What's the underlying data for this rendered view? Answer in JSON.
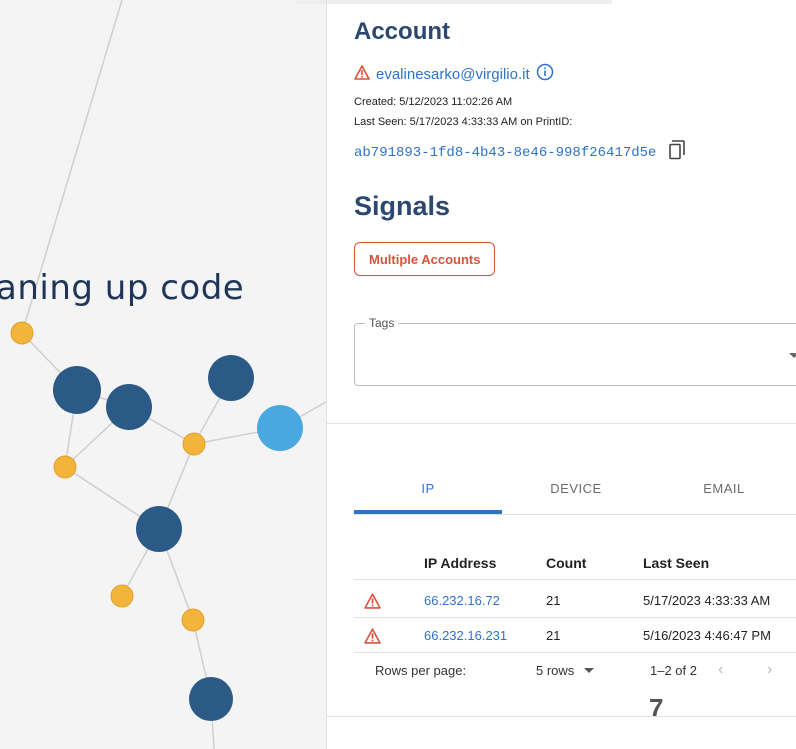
{
  "graph": {
    "label": "aning up code",
    "colors": {
      "edge": "#cfcfcf",
      "large": "#2c5a87",
      "small": "#f3b43b",
      "highlight": "#4aa8e0"
    }
  },
  "account": {
    "title": "Account",
    "email": "evalinesarko@virgilio.it",
    "created": "Created: 5/12/2023 11:02:26 AM",
    "last_seen": "Last Seen: 5/17/2023 4:33:33 AM on PrintID:",
    "print_id": "ab791893-1fd8-4b43-8e46-998f26417d5e"
  },
  "signals": {
    "title": "Signals",
    "chips": [
      "Multiple Accounts"
    ],
    "tags_label": "Tags"
  },
  "tabs": [
    {
      "label": "IP",
      "active": true
    },
    {
      "label": "DEVICE",
      "active": false
    },
    {
      "label": "EMAIL",
      "active": false
    }
  ],
  "table": {
    "columns": [
      "IP Address",
      "Count",
      "Last Seen"
    ],
    "rows": [
      {
        "ip": "66.232.16.72",
        "count": "21",
        "last_seen": "5/17/2023 4:33:33 AM"
      },
      {
        "ip": "66.232.16.231",
        "count": "21",
        "last_seen": "5/16/2023 4:46:47 PM"
      }
    ]
  },
  "pagination": {
    "rows_per_page_label": "Rows per page:",
    "rows_per_page_value": "5 rows",
    "range": "1–2 of 2",
    "prev": "‹",
    "next": "›"
  },
  "page_number": "7",
  "colors": {
    "accent": "#2f73c9",
    "title": "#2c4770",
    "warning": "#d9523a"
  }
}
